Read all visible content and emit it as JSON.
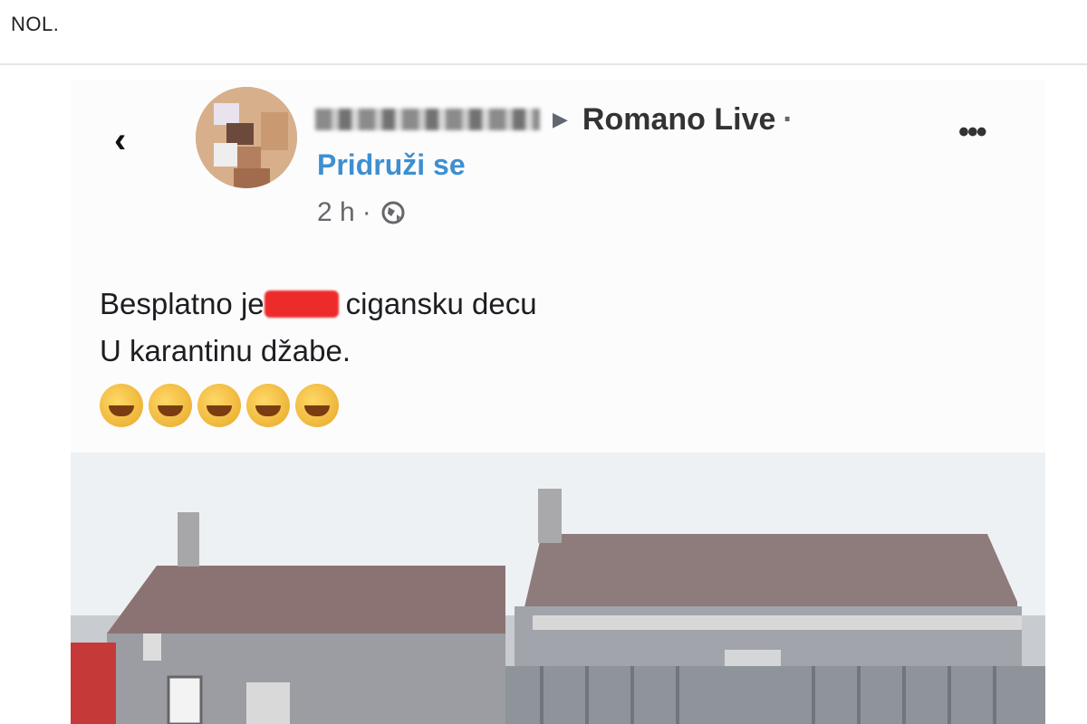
{
  "caption": "NOL.",
  "post": {
    "group": "Romano Live",
    "separator": "·",
    "join_label": "Pridruži se",
    "time": "2 h",
    "time_separator": "·",
    "text_line1_start": "Besplatno je",
    "text_line1_end": "cigansku decu",
    "text_line2": "U karantinu džabe.",
    "emoji_count": 5
  },
  "icons": {
    "back": "chevron-left-icon",
    "more": "more-options-icon",
    "privacy": "globe-icon"
  }
}
